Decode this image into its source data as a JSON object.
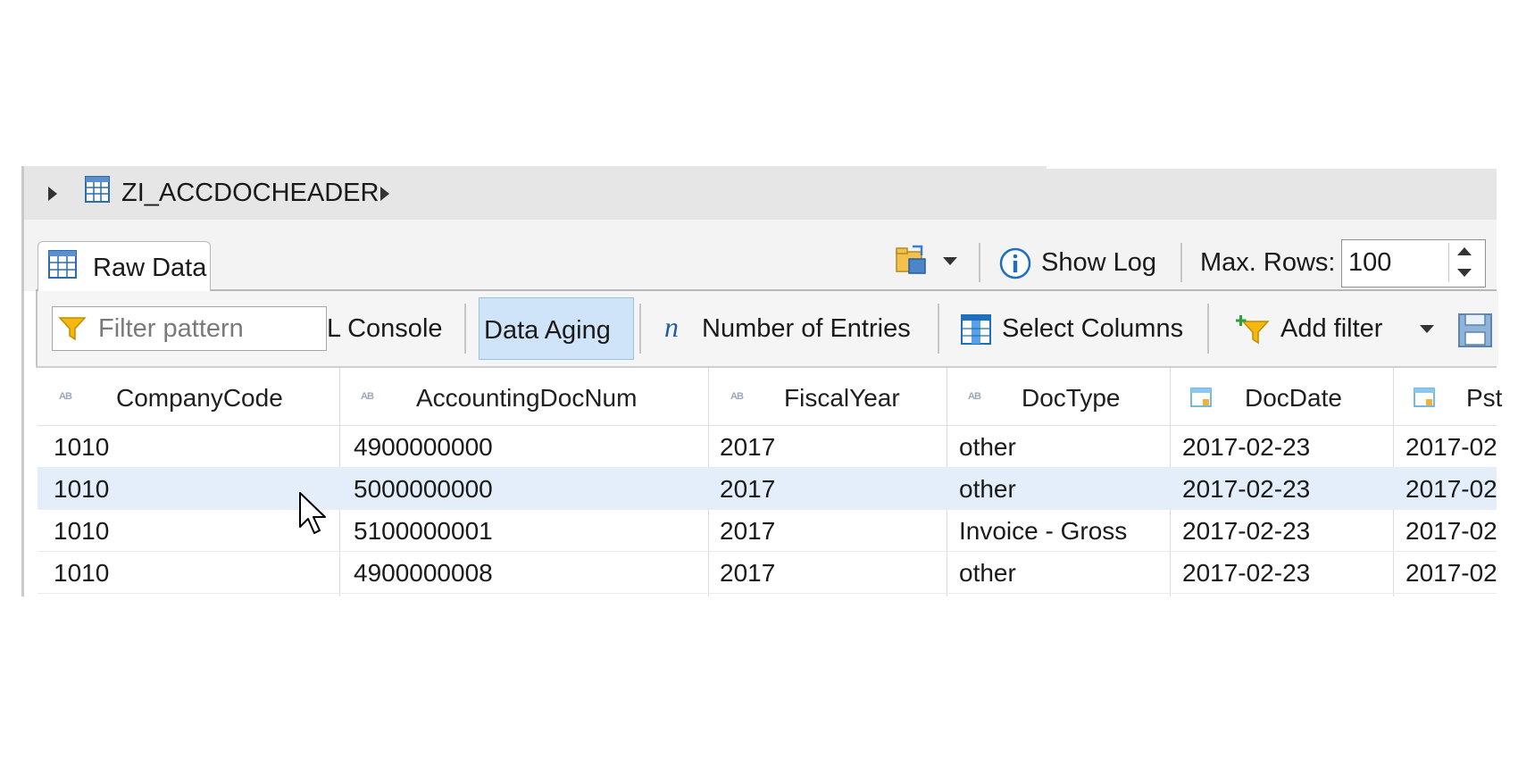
{
  "breadcrumb": {
    "entity": "ZI_ACCDOCHEADER"
  },
  "tab": {
    "label": "Raw Data"
  },
  "toolbar_top": {
    "show_log_label": "Show Log",
    "max_rows_label": "Max. Rows:",
    "max_rows_value": "100"
  },
  "toolbar": {
    "filter_placeholder": "Filter pattern",
    "sql_console_label": "L Console",
    "data_aging_label": "Data Aging",
    "number_of_entries_label": "Number of Entries",
    "select_columns_label": "Select Columns",
    "add_filter_label": "Add filter"
  },
  "table": {
    "columns": [
      "CompanyCode",
      "AccountingDocNum",
      "FiscalYear",
      "DocType",
      "DocDate",
      "Pst"
    ],
    "rows": [
      [
        "1010",
        "4900000000",
        "2017",
        "other",
        "2017-02-23",
        "2017-02"
      ],
      [
        "1010",
        "5000000000",
        "2017",
        "other",
        "2017-02-23",
        "2017-02"
      ],
      [
        "1010",
        "5100000001",
        "2017",
        "Invoice - Gross",
        "2017-02-23",
        "2017-02"
      ],
      [
        "1010",
        "4900000008",
        "2017",
        "other",
        "2017-02-23",
        "2017-02"
      ]
    ],
    "selected_row": 1
  },
  "colors": {
    "selection": "#e4eefb",
    "active_button": "#cfe4f8",
    "icon_blue": "#1f6fbf"
  }
}
